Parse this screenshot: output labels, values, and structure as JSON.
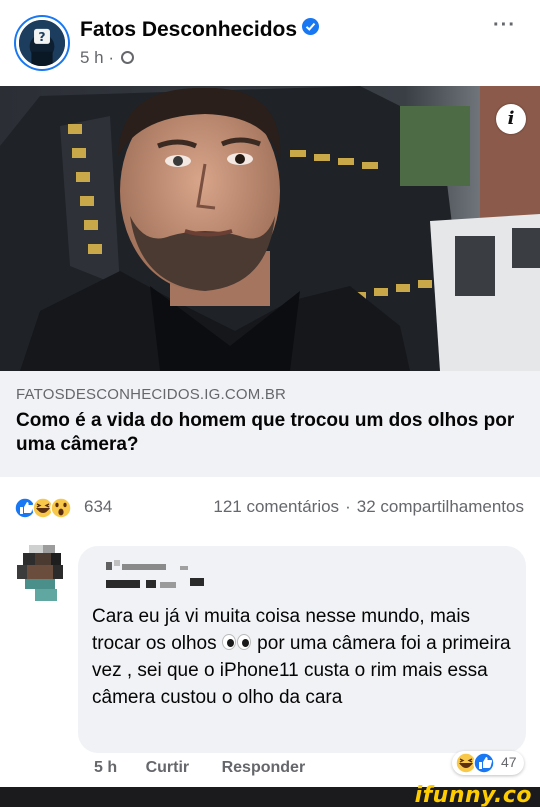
{
  "post": {
    "page_name": "Fatos Desconhecidos",
    "time": "5 h",
    "separator": "·",
    "more": "···",
    "avatar_mark": "?"
  },
  "link": {
    "info_label": "i",
    "domain": "FATOSDESCONHECIDOS.IG.COM.BR",
    "title": "Como é a vida do homem que trocou um dos olhos por uma câmera?"
  },
  "reactions": {
    "count": "634",
    "comments": "121 comentários",
    "shares": "32 compartilhamentos",
    "dot": "·"
  },
  "comment": {
    "text_part1": "Cara eu já vi muita coisa nesse mundo, mais trocar os olhos ",
    "text_part2": " por uma câmera foi a primeira vez , sei que o iPhone11 custa o rim mais essa câmera custou o olho da cara",
    "time": "5 h",
    "like_label": "Curtir",
    "reply_label": "Responder",
    "reaction_count": "47"
  },
  "footer": {
    "logo": "ifunny.co"
  },
  "colors": {
    "brand_blue": "#1877f2",
    "ifunny_yellow": "#ffcc00"
  }
}
